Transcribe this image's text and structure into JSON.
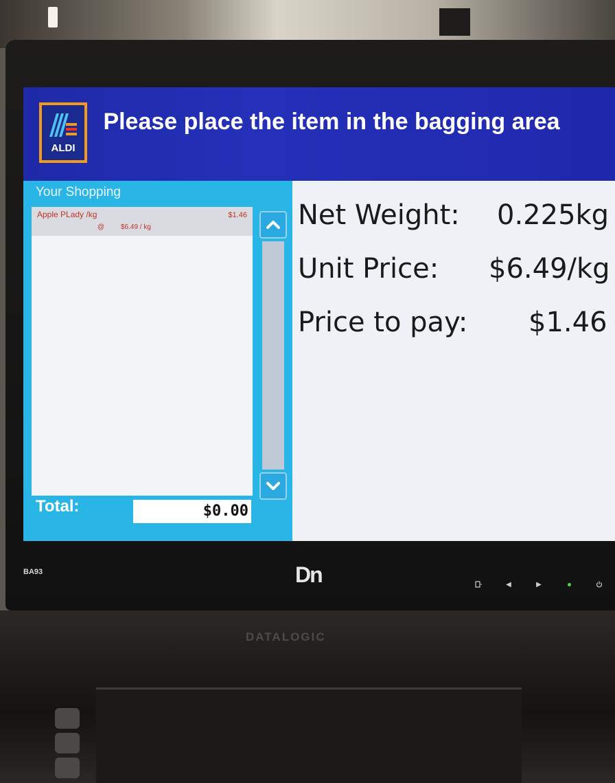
{
  "header": {
    "logo_text": "ALDI",
    "message": "Please place the item in the bagging area"
  },
  "shopping": {
    "title": "Your Shopping",
    "items": [
      {
        "name": "Apple PLady /kg",
        "price": "$1.46",
        "at_symbol": "@",
        "unit_price": "$6.49 / kg"
      }
    ],
    "total_label": "Total:",
    "total_value": "$0.00"
  },
  "details": {
    "net_weight_label": "Net Weight:",
    "net_weight_value": "0.225kg",
    "unit_price_label": "Unit Price:",
    "unit_price_value": "$6.49/kg",
    "price_to_pay_label": "Price to pay:",
    "price_to_pay_value": "$1.46"
  },
  "device": {
    "model": "BA93",
    "brand_logo": "Dn",
    "scanner_brand": "DATALOGIC"
  },
  "colors": {
    "header_blue": "#2430b8",
    "panel_cyan": "#29b6e6",
    "item_text_red": "#c2332a",
    "logo_orange": "#f39a1c"
  }
}
